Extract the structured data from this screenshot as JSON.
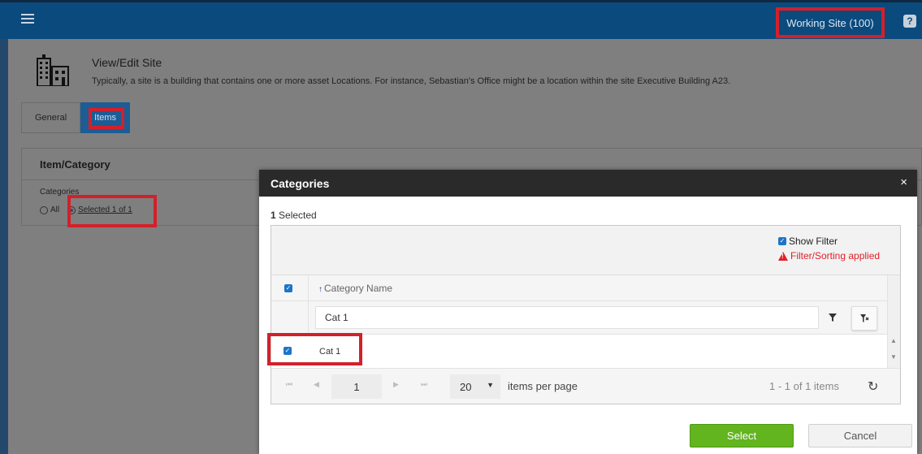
{
  "topbar": {
    "working_site": "Working Site (100)",
    "help_label": "?"
  },
  "page": {
    "title": "View/Edit Site",
    "description": "Typically, a site is a building that contains one or more asset Locations. For instance, Sebastian's Office might be a location within the site Executive Building A23.",
    "tabs": [
      {
        "label": "General",
        "active": false
      },
      {
        "label": "Items",
        "active": true
      }
    ],
    "panel": {
      "title": "Item/Category",
      "categories_label": "Categories",
      "radio_all": "All",
      "radio_selected": "Selected 1 of 1"
    }
  },
  "modal": {
    "title": "Categories",
    "close": "×",
    "selected_count": "1",
    "selected_label": " Selected",
    "show_filter": "Show Filter",
    "filter_applied": "Filter/Sorting applied",
    "column_header": "Category Name",
    "sort_glyph": "↑",
    "filter_value": "Cat 1",
    "rows": [
      {
        "name": "Cat 1",
        "checked": true
      }
    ],
    "pager": {
      "page": "1",
      "page_size": "20",
      "per_page_label": "items per page",
      "range": "1 - 1 of 1 items"
    },
    "select_label": "Select",
    "cancel_label": "Cancel"
  },
  "colors": {
    "topbar": "#0b4a7d",
    "accent": "#1e74c8",
    "highlight": "#d3202a",
    "select_button": "#62b51f",
    "warning": "#e0202a"
  },
  "icons": [
    "menu-icon",
    "help-icon",
    "building-icon",
    "close-icon",
    "warning-icon",
    "sort-ascending-icon",
    "filter-icon",
    "clear-filter-icon",
    "first-page-icon",
    "prev-page-icon",
    "next-page-icon",
    "last-page-icon",
    "dropdown-icon",
    "refresh-icon"
  ]
}
